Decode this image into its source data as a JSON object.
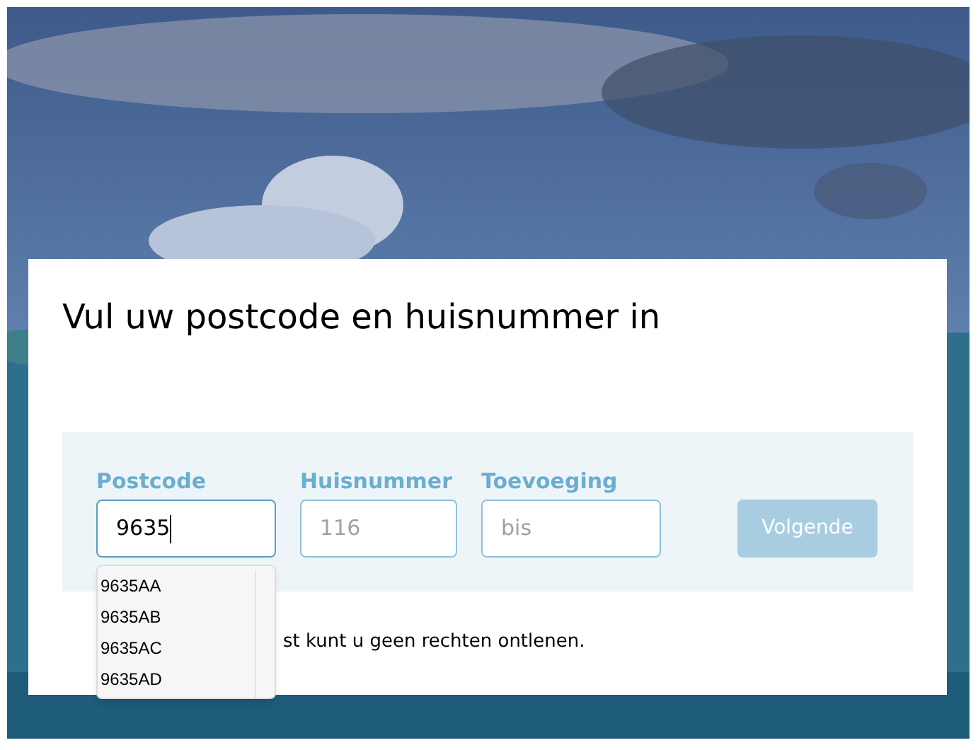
{
  "card": {
    "title": "Vul uw postcode en huisnummer in",
    "form": {
      "fields": [
        {
          "label": "Postcode",
          "value": "9635",
          "focused": true
        },
        {
          "label": "Huisnummer",
          "placeholder": "116",
          "focused": false
        },
        {
          "label": "Toevoeging",
          "placeholder": "bis",
          "focused": false
        }
      ],
      "button": {
        "label": "Volgende",
        "disabled": true
      }
    },
    "note": "st kunt u geen rechten ontlenen."
  },
  "suggestions": [
    "9635AA",
    "9635AB",
    "9635AC",
    "9635AD"
  ]
}
